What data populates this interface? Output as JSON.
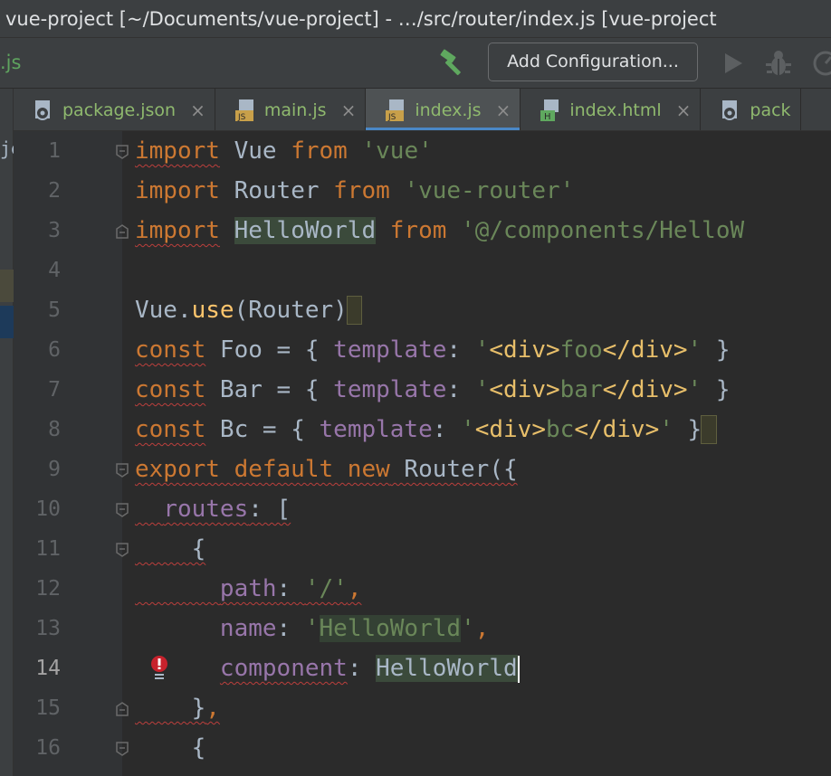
{
  "window": {
    "title": "vue-project [~/Documents/vue-project] - …/src/router/index.js [vue-project"
  },
  "toolbar": {
    "crumb": ".js",
    "add_configuration_label": "Add Configuration...",
    "icons": [
      "hammer-icon",
      "run-icon",
      "debug-icon",
      "profile-icon"
    ]
  },
  "left_panel": {
    "fragment": "je"
  },
  "tabs": [
    {
      "label": "package.json",
      "icon": "npm-json-icon",
      "active": false
    },
    {
      "label": "main.js",
      "icon": "js-file-icon",
      "active": false
    },
    {
      "label": "index.js",
      "icon": "js-file-icon",
      "active": true
    },
    {
      "label": "index.html",
      "icon": "html-file-icon",
      "active": false
    },
    {
      "label": "pack",
      "icon": "npm-json-icon",
      "active": false
    }
  ],
  "tab_close_glyph": "×",
  "editor": {
    "current_line": 14,
    "line_numbers": [
      "1",
      "2",
      "3",
      "4",
      "5",
      "6",
      "7",
      "8",
      "9",
      "10",
      "11",
      "12",
      "13",
      "14",
      "15",
      "16"
    ],
    "lines": [
      "import Vue from 'vue'",
      "import Router from 'vue-router'",
      "import HelloWorld from '@/components/HelloW",
      "",
      "Vue.use(Router)",
      "const Foo = { template: '<div>foo</div>' }",
      "const Bar = { template: '<div>bar</div>' }",
      "const Bc = { template: '<div>bc</div>' }",
      "export default new Router({",
      "  routes: [",
      "    {",
      "      path: '/',",
      "      name: 'HelloWorld',",
      "      component: HelloWorld",
      "    },",
      "    {"
    ]
  },
  "colors": {
    "keyword": "#cc7832",
    "string": "#6a8759",
    "property": "#9876aa",
    "function": "#ffc66d",
    "tag": "#e8bf6a",
    "text": "#a9b7c6",
    "error_underline": "#bc3f3c",
    "active_tab_underline": "#4a88c7"
  }
}
